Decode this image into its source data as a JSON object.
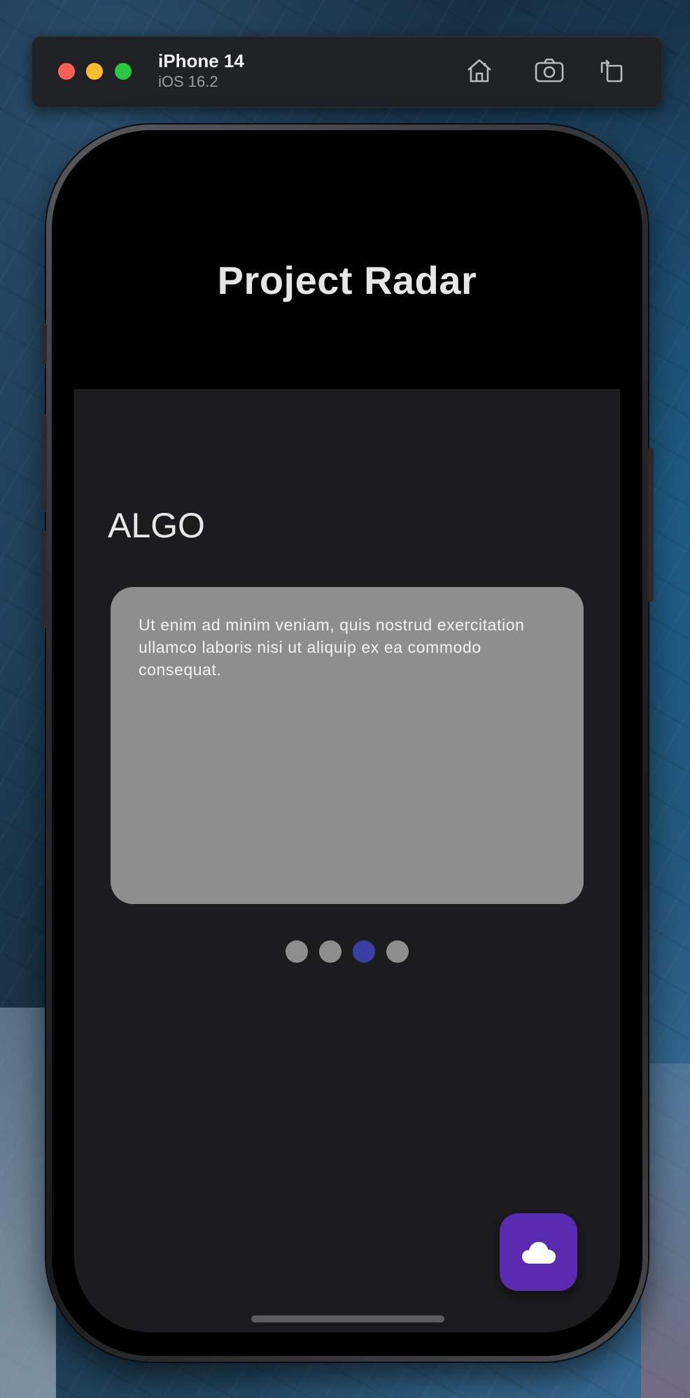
{
  "simulator": {
    "device_name": "iPhone 14",
    "os_version": "iOS 16.2",
    "buttons": [
      "home-icon",
      "screenshot-icon",
      "rotate-icon"
    ]
  },
  "app": {
    "title": "Project Radar"
  },
  "page": {
    "section_title": "ALGO",
    "card_text": "Ut enim ad minim veniam, quis nostrud exercitation ullamco laboris nisi ut aliquip ex ea commodo consequat.",
    "pager": {
      "total": 4,
      "active_index": 2
    }
  },
  "fab": {
    "icon": "cloud-icon",
    "color": "#5a2bb1"
  },
  "colors": {
    "header_bg": "#000000",
    "screen_bg": "#1c1c1e",
    "card_bg": "#8e8e8e",
    "dot_inactive": "#8e8e8e",
    "dot_active": "#3b3fa3"
  }
}
